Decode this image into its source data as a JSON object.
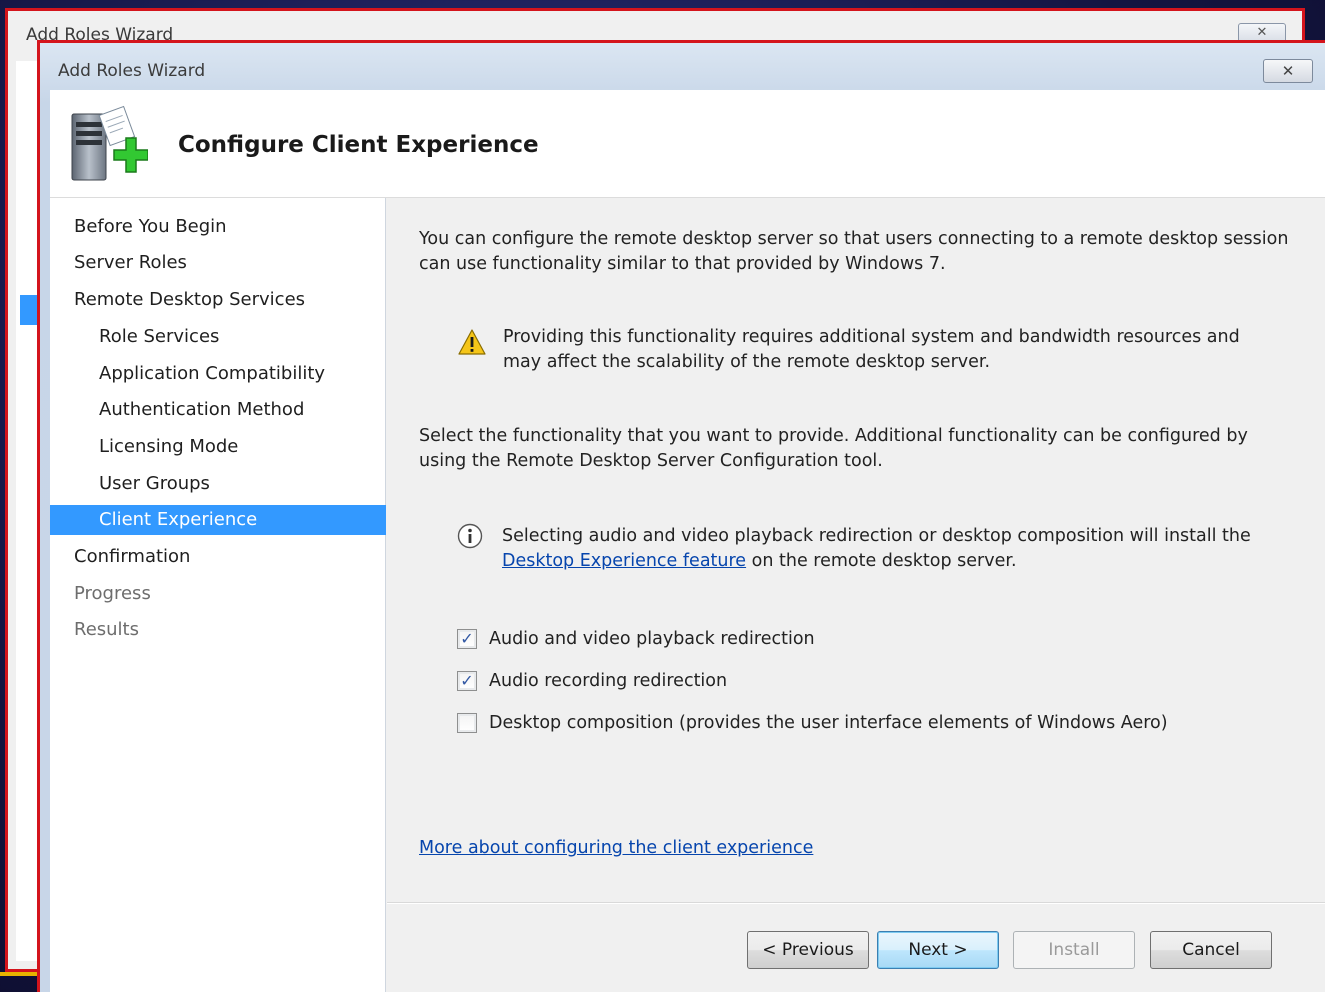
{
  "background_window": {
    "title": "Add Roles Wizard",
    "close_glyph": "✕"
  },
  "window": {
    "title": "Add Roles Wizard",
    "close_glyph": "✕"
  },
  "header": {
    "title": "Configure Client Experience",
    "icon": "server-add-icon"
  },
  "nav": {
    "items": [
      {
        "label": "Before You Begin",
        "level": 0,
        "state": "normal"
      },
      {
        "label": "Server Roles",
        "level": 0,
        "state": "normal"
      },
      {
        "label": "Remote Desktop Services",
        "level": 0,
        "state": "normal"
      },
      {
        "label": "Role Services",
        "level": 1,
        "state": "normal"
      },
      {
        "label": "Application Compatibility",
        "level": 1,
        "state": "normal"
      },
      {
        "label": "Authentication Method",
        "level": 1,
        "state": "normal"
      },
      {
        "label": "Licensing Mode",
        "level": 1,
        "state": "normal"
      },
      {
        "label": "User Groups",
        "level": 1,
        "state": "normal"
      },
      {
        "label": "Client Experience",
        "level": 1,
        "state": "selected"
      },
      {
        "label": "Confirmation",
        "level": 0,
        "state": "normal"
      },
      {
        "label": "Progress",
        "level": 0,
        "state": "disabled"
      },
      {
        "label": "Results",
        "level": 0,
        "state": "disabled"
      }
    ]
  },
  "content": {
    "intro_line1": "You can configure the remote desktop server so that users connecting to a remote desktop session",
    "intro_line2": "can use functionality similar to that provided by Windows 7.",
    "warning_line1": "Providing this functionality requires additional system and bandwidth resources and",
    "warning_line2": "may affect the scalability of the remote desktop server.",
    "select_line1": "Select the functionality that you want to provide. Additional functionality can be configured by",
    "select_line2": "using the Remote Desktop Server Configuration tool.",
    "info_line1": "Selecting audio and video playback redirection or desktop composition will install the",
    "info_link": "Desktop Experience feature",
    "info_line2_rest": " on the remote desktop server.",
    "options": [
      {
        "label": "Audio and video playback redirection",
        "checked": true
      },
      {
        "label": "Audio recording redirection",
        "checked": true
      },
      {
        "label": "Desktop composition (provides the user interface elements of Windows Aero)",
        "checked": false
      }
    ],
    "more_link": "More about configuring the client experience"
  },
  "buttons": {
    "previous": "< Previous",
    "next": "Next >",
    "install": "Install",
    "cancel": "Cancel"
  },
  "colors": {
    "selection": "#3399ff",
    "link": "#0645ad",
    "frame_highlight": "#d4141c"
  }
}
